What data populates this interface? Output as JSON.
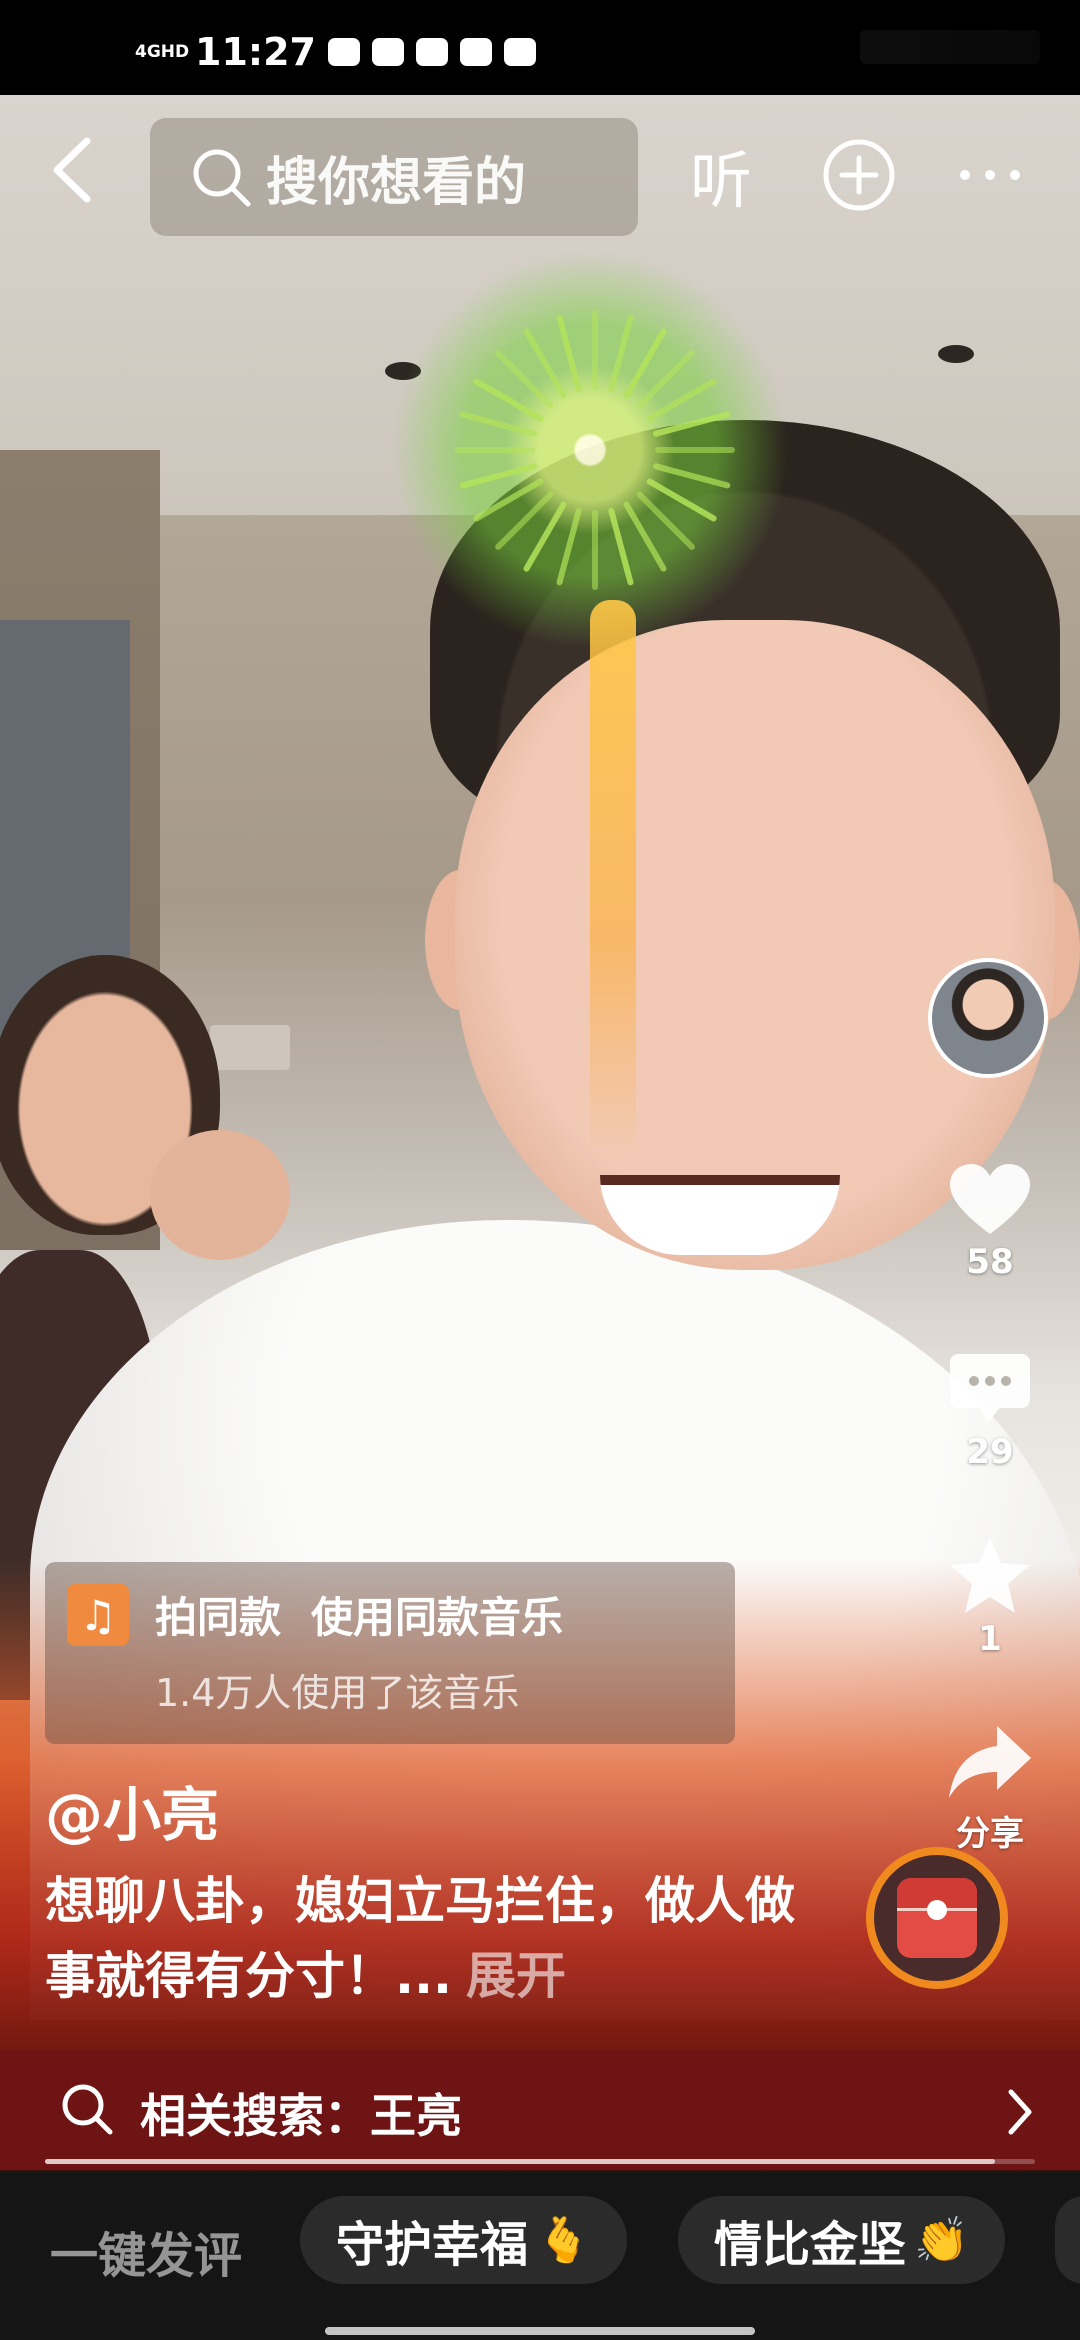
{
  "status_bar": {
    "network": "4GHD",
    "time": "11:27",
    "notification_icons": [
      "mail-icon",
      "mail-icon",
      "square-icon",
      "app-icon",
      "book-icon"
    ]
  },
  "top_bar": {
    "search_placeholder": "搜你想看的",
    "listen_label": "听"
  },
  "rail": {
    "like_count": "58",
    "comment_count": "29",
    "favorite_count": "1",
    "share_label": "分享"
  },
  "music": {
    "action_label": "拍同款",
    "use_label": "使用同款音乐",
    "users_text": "1.4万人使用了该音乐"
  },
  "caption": {
    "author": "@小亮",
    "text": "想聊八卦，媳妇立马拦住，做人做事就得有分寸！...",
    "expand_label": "展开"
  },
  "related": {
    "label": "相关搜索：王亮",
    "progress": 0.96
  },
  "quick_comment": {
    "label": "一键发评",
    "chips": [
      {
        "text": "守护幸福",
        "emoji": "🫰"
      },
      {
        "text": "情比金坚",
        "emoji": "👏"
      }
    ]
  },
  "colors": {
    "accent_orange": "#f08a1e",
    "related_bar": "#6f1414",
    "music_icon": "#f08a3e"
  }
}
